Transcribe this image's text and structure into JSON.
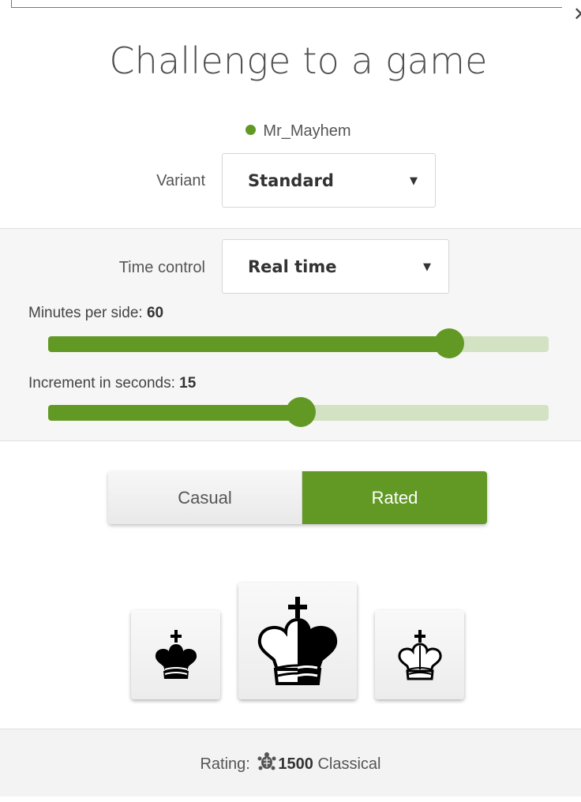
{
  "dialog": {
    "title": "Challenge to a game",
    "close_icon": "close-icon"
  },
  "opponent": {
    "name": "Mr_Mayhem",
    "status_color": "#629924"
  },
  "variant": {
    "label": "Variant",
    "value": "Standard"
  },
  "time_control": {
    "label": "Time control",
    "value": "Real time"
  },
  "minutes": {
    "label": "Minutes per side: ",
    "value": "60",
    "fraction": 0.802
  },
  "increment": {
    "label": "Increment in seconds: ",
    "value": "15",
    "fraction": 0.505
  },
  "mode": {
    "casual": "Casual",
    "rated": "Rated",
    "selected": "rated"
  },
  "colors": {
    "black": "black-king-icon",
    "random": "random-king-icon",
    "white": "white-king-icon"
  },
  "rating": {
    "label": "Rating: ",
    "value": "1500",
    "perf": " Classical",
    "icon": "turtle-icon"
  },
  "theme": {
    "accent": "#629924",
    "accent_light": "#d3e2c2"
  }
}
